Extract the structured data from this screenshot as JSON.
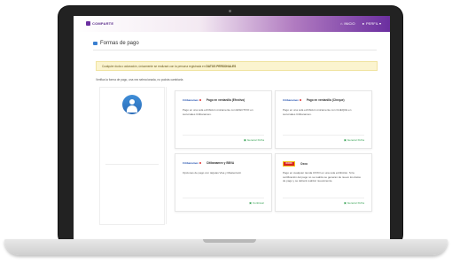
{
  "app": {
    "logo_text": "COMPARTE",
    "brand_color": "#6b2fa0"
  },
  "nav": {
    "items": [
      {
        "label": "INICIO",
        "icon": "home-icon"
      },
      {
        "label": "PERFIL ▾",
        "icon": "user-icon"
      }
    ]
  },
  "page": {
    "title": "Formas de pago",
    "alert_prefix": "Cualquier duda o aclaración, únicamente se realizará con la persona registrada en ",
    "alert_bold": "DATOS PERSONALES",
    "hint": "Verifica la forma de pago, una vez seleccionada, no podrás cambiarla"
  },
  "payment_methods": [
    {
      "brand": "Citibanamex",
      "title": "Pago en ventanilla (Efectivo)",
      "description": "Pago en una sola exhibición únicamente con EFECTIVO en sucursales Citibanamex.",
      "action": "Generar Ficha"
    },
    {
      "brand": "Citibanamex",
      "title": "Pago en ventanilla (Cheque)",
      "description": "Pago en una sola exhibición únicamente con CHEQUE en sucursales Citibanamex.",
      "action": "Generar Ficha"
    },
    {
      "brand": "Citibanamex",
      "title": "Citibanamex y BBVA",
      "description": "Opciones de pago con tarjetas Visa y Mastercard.",
      "action": "Continuar"
    },
    {
      "brand": "OXXO",
      "title": "Oxxo",
      "description": "Pago en cualquier tienda OXXO en una sola exhibición. Si la certificación del pago no se realiza se generan de nuevo los datos de pago y se deberá realizar nuevamente.",
      "action": "Generar Ficha"
    }
  ]
}
